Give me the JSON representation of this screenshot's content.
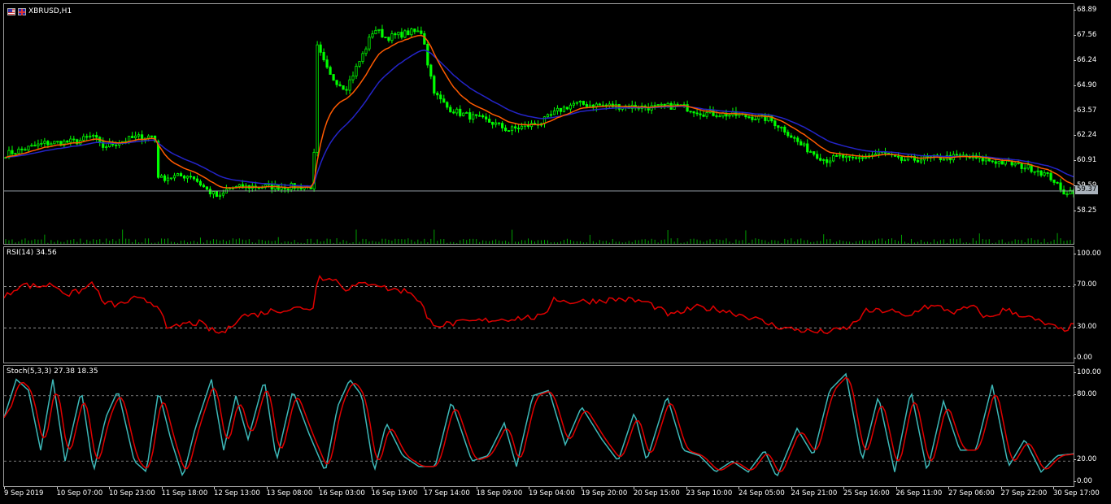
{
  "symbol": {
    "title": "XBRUSD,H1",
    "icons": [
      "us-flag-icon",
      "uk-flag-icon"
    ]
  },
  "colors": {
    "background": "#000000",
    "candle": "#00ff00",
    "ma_fast": "#ff5a00",
    "ma_slow": "#2424c8",
    "volume": "#00a000",
    "rsi_line": "#e00000",
    "stoch_main": "#3db8b8",
    "stoch_signal": "#e00000",
    "bid_line": "#a9b2bb",
    "grid_text": "#ffffff"
  },
  "price_panel": {
    "axis_labels": [
      "68.89",
      "67.56",
      "66.24",
      "64.90",
      "63.57",
      "62.24",
      "60.91",
      "59.59",
      "58.25"
    ],
    "current_price": "59.37"
  },
  "rsi_panel": {
    "label": "RSI(14) 34.56",
    "axis_labels": [
      "100.00",
      "70.00",
      "30.00",
      "0.00"
    ]
  },
  "stoch_panel": {
    "label": "Stoch(5,3,3) 27.38 18.35",
    "axis_labels": [
      "100.00",
      "80.00",
      "20.00",
      "0.00"
    ]
  },
  "time_axis": [
    "9 Sep 2019",
    "10 Sep 07:00",
    "10 Sep 23:00",
    "11 Sep 18:00",
    "12 Sep 13:00",
    "13 Sep 08:00",
    "16 Sep 03:00",
    "16 Sep 19:00",
    "17 Sep 14:00",
    "18 Sep 09:00",
    "19 Sep 04:00",
    "19 Sep 20:00",
    "20 Sep 15:00",
    "23 Sep 10:00",
    "24 Sep 05:00",
    "24 Sep 21:00",
    "25 Sep 16:00",
    "26 Sep 11:00",
    "27 Sep 06:00",
    "27 Sep 22:00",
    "30 Sep 17:00"
  ],
  "chart_data": {
    "type": "line",
    "title": "XBRUSD,H1",
    "price_path": {
      "x": [
        0,
        50,
        90,
        110,
        120,
        160,
        185,
        190,
        200,
        230,
        250,
        265,
        275,
        300,
        330,
        380,
        385,
        390,
        400,
        420,
        440,
        455,
        470,
        500,
        515,
        520,
        530,
        545,
        560,
        600,
        620,
        660,
        680,
        700,
        740,
        800,
        830,
        860,
        900,
        940,
        960,
        980,
        1010,
        1030,
        1040,
        1080,
        1100,
        1140,
        1180,
        1210,
        1240,
        1270,
        1290,
        1300,
        1317
      ],
      "y": [
        61.3,
        61.9,
        62.0,
        62.3,
        61.7,
        62.2,
        62.3,
        60.0,
        60.1,
        60.2,
        59.4,
        59.0,
        59.5,
        59.6,
        59.6,
        59.6,
        67.0,
        66.5,
        65.5,
        64.8,
        66.5,
        68.0,
        67.5,
        67.8,
        67.8,
        66.3,
        64.5,
        63.8,
        63.5,
        63.0,
        62.6,
        63.0,
        63.6,
        64.0,
        63.9,
        63.8,
        63.9,
        63.5,
        63.4,
        63.2,
        62.6,
        61.8,
        61.0,
        61.2,
        61.0,
        61.4,
        61.0,
        61.1,
        61.2,
        61.0,
        60.8,
        60.5,
        60.0,
        59.3,
        59.4
      ]
    },
    "ma_fast_period_hint": "fast",
    "rsi": {
      "x": [
        0,
        20,
        40,
        60,
        80,
        100,
        110,
        120,
        140,
        160,
        180,
        195,
        200,
        220,
        240,
        255,
        265,
        275,
        290,
        310,
        330,
        350,
        370,
        382,
        385,
        395,
        405,
        420,
        440,
        455,
        470,
        500,
        515,
        520,
        535,
        560,
        600,
        640,
        665,
        675,
        690,
        720,
        760,
        790,
        820,
        850,
        880,
        920,
        940,
        960,
        980,
        1000,
        1020,
        1040,
        1060,
        1090,
        1110,
        1130,
        1150,
        1170,
        1190,
        1210,
        1230,
        1250,
        1280,
        1300,
        1317
      ],
      "y": [
        59,
        72,
        70,
        72,
        62,
        68,
        75,
        55,
        52,
        58,
        55,
        48,
        27,
        34,
        35,
        28,
        25,
        28,
        42,
        43,
        47,
        48,
        50,
        48,
        85,
        76,
        78,
        68,
        72,
        74,
        68,
        65,
        52,
        38,
        33,
        35,
        38,
        40,
        41,
        60,
        55,
        56,
        58,
        55,
        42,
        50,
        48,
        40,
        34,
        30,
        28,
        26,
        27,
        31,
        46,
        47,
        40,
        51,
        50,
        45,
        51,
        39,
        48,
        43,
        34,
        28,
        33
      ]
    },
    "stoch_main": {
      "x": [
        0,
        15,
        30,
        45,
        60,
        75,
        95,
        110,
        125,
        140,
        160,
        175,
        190,
        205,
        220,
        235,
        255,
        270,
        285,
        300,
        320,
        335,
        355,
        375,
        395,
        410,
        425,
        440,
        455,
        470,
        490,
        510,
        530,
        550,
        575,
        595,
        615,
        630,
        650,
        670,
        690,
        710,
        735,
        755,
        775,
        790,
        815,
        835,
        855,
        875,
        895,
        915,
        935,
        950,
        975,
        995,
        1015,
        1035,
        1055,
        1075,
        1095,
        1115,
        1135,
        1155,
        1175,
        1195,
        1215,
        1235,
        1255,
        1275,
        1295,
        1317
      ],
      "y": [
        60,
        95,
        85,
        30,
        95,
        20,
        85,
        10,
        60,
        85,
        20,
        10,
        85,
        40,
        5,
        50,
        95,
        30,
        80,
        40,
        95,
        20,
        85,
        45,
        10,
        70,
        95,
        80,
        10,
        55,
        25,
        15,
        15,
        75,
        20,
        25,
        55,
        15,
        80,
        85,
        35,
        70,
        40,
        20,
        65,
        20,
        80,
        30,
        25,
        10,
        20,
        10,
        30,
        5,
        50,
        25,
        85,
        100,
        20,
        80,
        10,
        85,
        10,
        75,
        30,
        30,
        90,
        15,
        40,
        10,
        25,
        27
      ]
    },
    "stoch_signal_lag": true,
    "volume": {
      "note": "hourly tick volume bars"
    },
    "ylim_price": [
      57.6,
      69.2
    ],
    "ylim_rsi": [
      0,
      100
    ],
    "ylim_stoch": [
      0,
      100
    ]
  }
}
